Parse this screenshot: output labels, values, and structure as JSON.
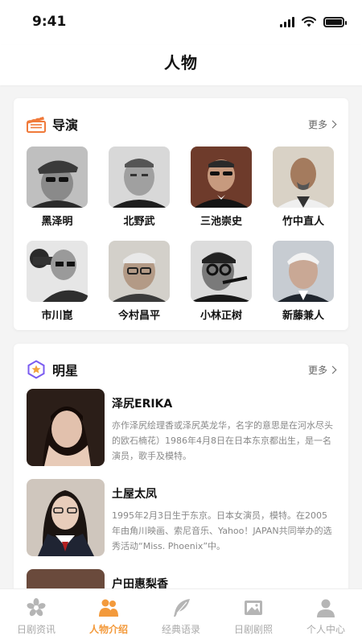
{
  "status": {
    "time": "9:41"
  },
  "header": {
    "title": "人物"
  },
  "directors": {
    "title": "导演",
    "more_label": "更多",
    "icon": "clapperboard-icon",
    "items": [
      {
        "name": "黑泽明"
      },
      {
        "name": "北野武"
      },
      {
        "name": "三池崇史"
      },
      {
        "name": "竹中直人"
      },
      {
        "name": "市川崑"
      },
      {
        "name": "今村昌平"
      },
      {
        "name": "小林正树"
      },
      {
        "name": "新藤兼人"
      }
    ]
  },
  "stars": {
    "title": "明星",
    "more_label": "更多",
    "icon": "star-hexagon-icon",
    "items": [
      {
        "name": "泽尻ERIKA",
        "desc": "亦作泽尻绘理香或泽尻英龙华，名字的意思是在河水尽头的欧石楠花）1986年4月8日在日本东京都出生，是一名演员，歌手及模特。"
      },
      {
        "name": "土屋太凤",
        "desc": "1995年2月3日生于东京。日本女演员，模特。在2005年由角川映画、索尼音乐、Yahoo！JAPAN共同举办的选秀活动“Miss. Phoenix”中。"
      },
      {
        "name": "户田惠梨香",
        "desc": ""
      }
    ]
  },
  "tabs": [
    {
      "label": "日剧资讯",
      "icon": "sakura-icon",
      "active": false
    },
    {
      "label": "人物介绍",
      "icon": "people-icon",
      "active": true
    },
    {
      "label": "经典语录",
      "icon": "feather-icon",
      "active": false
    },
    {
      "label": "日剧剧照",
      "icon": "photo-icon",
      "active": false
    },
    {
      "label": "个人中心",
      "icon": "person-icon",
      "active": false
    }
  ],
  "colors": {
    "accent": "#f39a3c",
    "inactive": "#aaaaaa",
    "star_icon": "#7b5cf0"
  }
}
